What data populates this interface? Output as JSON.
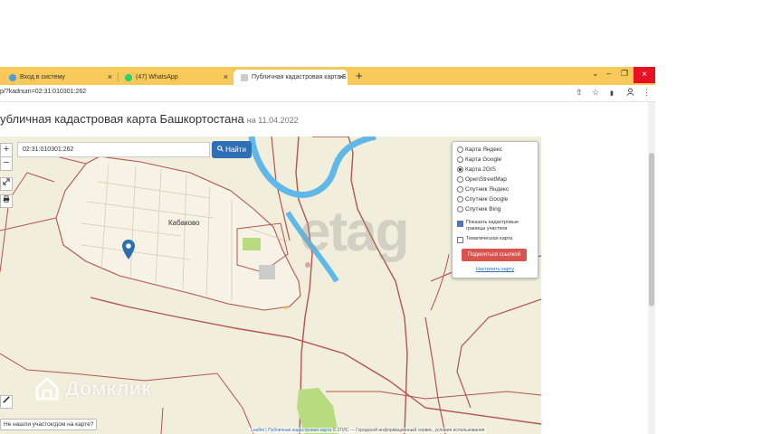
{
  "browser": {
    "tabs": [
      {
        "label": "Вход в систему",
        "fav_color": "#4a9fd8",
        "active": false
      },
      {
        "label": "(47) WhatsApp",
        "fav_color": "#25d366",
        "active": false
      },
      {
        "label": "Публичная кадастровая карта Б",
        "fav_color": "#cccccc",
        "active": true
      }
    ],
    "new_tab": "+",
    "tab_close": "×",
    "window_controls": {
      "dropdown": "⌄",
      "minimize": "–",
      "restore": "❐",
      "close": "×"
    },
    "address": "p/?kadnum=02:31:010301:262",
    "address_icons": {
      "share": "⇧",
      "star": "☆",
      "sidebar": "▮",
      "menu": "⋮"
    }
  },
  "page": {
    "title": "убличная кадастровая карта Башкортостана",
    "date": "на 11.04.2022"
  },
  "map": {
    "search_value": "02:31:010301:262",
    "find_label": "Найти",
    "find_icon": "search-icon",
    "zoom_in": "+",
    "zoom_out": "−",
    "place_label": "Кабаково",
    "watermark": "etag",
    "layers": [
      {
        "label": "Карта Яндекс",
        "selected": false
      },
      {
        "label": "Карта Google",
        "selected": false
      },
      {
        "label": "Карта 2GIS",
        "selected": true
      },
      {
        "label": "OpenStreetMap",
        "selected": false
      },
      {
        "label": "Спутник Яндекс",
        "selected": false
      },
      {
        "label": "Спутник Google",
        "selected": false
      },
      {
        "label": "Спутник Bing",
        "selected": false
      }
    ],
    "show_borders_label": "Показать кадастровые границы участков",
    "thematic_label": "Тематическая карта",
    "share_label": "Поделиться ссылкой",
    "setup_label": "Настроить карту",
    "not_found_label": "Не нашли участок/дом на карте?",
    "attribution": {
      "leaflet": "Leaflet",
      "pkk": "Публичная кадастровая карта",
      "rest": "© 2ГИС — Городской информационный сервис, условия использования"
    }
  },
  "overlay": {
    "domclick": "Домклик"
  },
  "colors": {
    "tabbar": "#f7c95a",
    "map_bg": "#f1eedb",
    "river": "#5fb8e8",
    "cadastral": "#b5544f",
    "find_button": "#2f6fb5",
    "share_button": "#d9534f",
    "park": "#b7dc7f"
  }
}
